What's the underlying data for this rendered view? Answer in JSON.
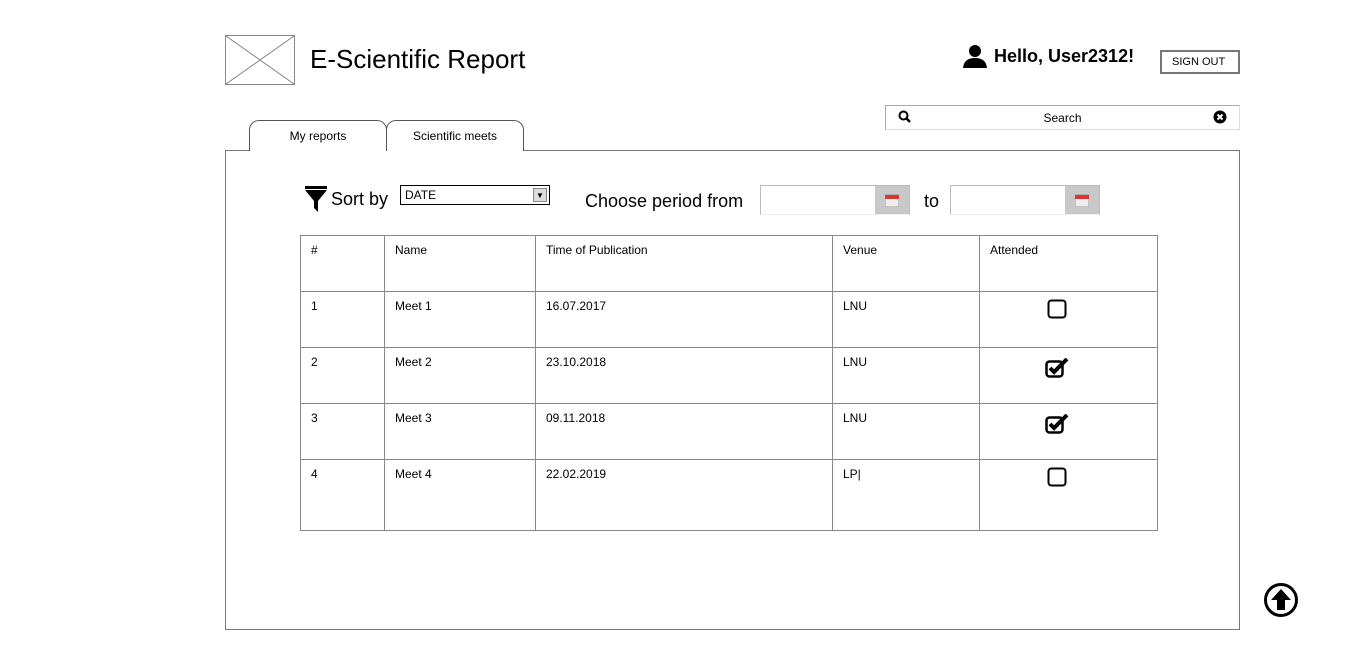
{
  "header": {
    "title": "E-Scientific Report",
    "greeting": "Hello, User2312!",
    "sign_out": "SIGN OUT"
  },
  "search": {
    "placeholder": "Search"
  },
  "tabs": [
    {
      "label": "My reports"
    },
    {
      "label": "Scientific meets",
      "active": true
    }
  ],
  "filters": {
    "sort_label": "Sort by",
    "sort_value": "DATE",
    "period_label": "Choose period from",
    "to_label": "to",
    "from_value": "",
    "to_value": ""
  },
  "table": {
    "columns": [
      "#",
      "Name",
      "Time of Publication",
      "Venue",
      "Attended"
    ],
    "rows": [
      {
        "num": "1",
        "name": "Meet 1",
        "time": "16.07.2017",
        "venue": "LNU",
        "attended": false
      },
      {
        "num": "2",
        "name": "Meet 2",
        "time": "23.10.2018",
        "venue": "LNU",
        "attended": true
      },
      {
        "num": "3",
        "name": "Meet 3",
        "time": "09.11.2018",
        "venue": "LNU",
        "attended": true
      },
      {
        "num": "4",
        "name": "Meet 4",
        "time": "22.02.2019",
        "venue": "LP|",
        "attended": false
      }
    ]
  }
}
